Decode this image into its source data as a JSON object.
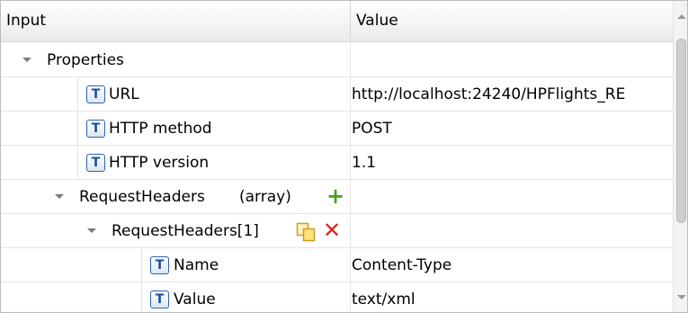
{
  "header": {
    "input_label": "Input",
    "value_label": "Value"
  },
  "rows": [
    {
      "name": "Properties",
      "value": ""
    },
    {
      "name": "URL",
      "value": "http://localhost:24240/HPFlights_RE"
    },
    {
      "name": "HTTP method",
      "value": "POST"
    },
    {
      "name": "HTTP version",
      "value": "1.1"
    },
    {
      "name": "RequestHeaders",
      "suffix": "(array)",
      "value": ""
    },
    {
      "name": "RequestHeaders[1]",
      "value": ""
    },
    {
      "name": "Name",
      "value": "Content-Type"
    },
    {
      "name": "Value",
      "value": "text/xml"
    }
  ],
  "icons": {
    "text_type": "T",
    "add": "+",
    "delete": "✕"
  },
  "colors": {
    "add": "#3fa320",
    "delete": "#e0231a",
    "type_icon": "#2a62b8"
  }
}
